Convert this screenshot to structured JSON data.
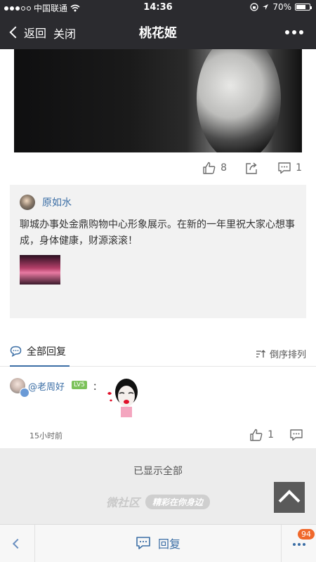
{
  "status_bar": {
    "carrier": "中国联通",
    "time": "14:36",
    "battery": "70%",
    "battery_level": 0.7
  },
  "nav": {
    "back_label": "返回",
    "close_label": "关闭",
    "title": "桃花姬"
  },
  "post": {
    "likes": "8",
    "comments": "1"
  },
  "quote": {
    "author": "原如水",
    "text": "聊城办事处金鼎购物中心形象展示。在新的一年里祝大家心想事成，身体健康，财源滚滚！"
  },
  "replies": {
    "tab_label": "全部回复",
    "sort_label": "倒序排列",
    "items": [
      {
        "author": "@老周好",
        "level": "LV5",
        "colon": "：",
        "time": "15小时前",
        "likes": "1"
      }
    ]
  },
  "footer": {
    "all_shown": "已显示全部",
    "brand": "微社区",
    "tagline": "精彩在你身边"
  },
  "bottom_bar": {
    "reply_label": "回复",
    "badge_count": "94"
  },
  "colors": {
    "nav_bg": "#2b2b2f",
    "link_blue": "#3b6ea5",
    "level_green": "#7cc25a",
    "badge_orange": "#f0682b"
  }
}
